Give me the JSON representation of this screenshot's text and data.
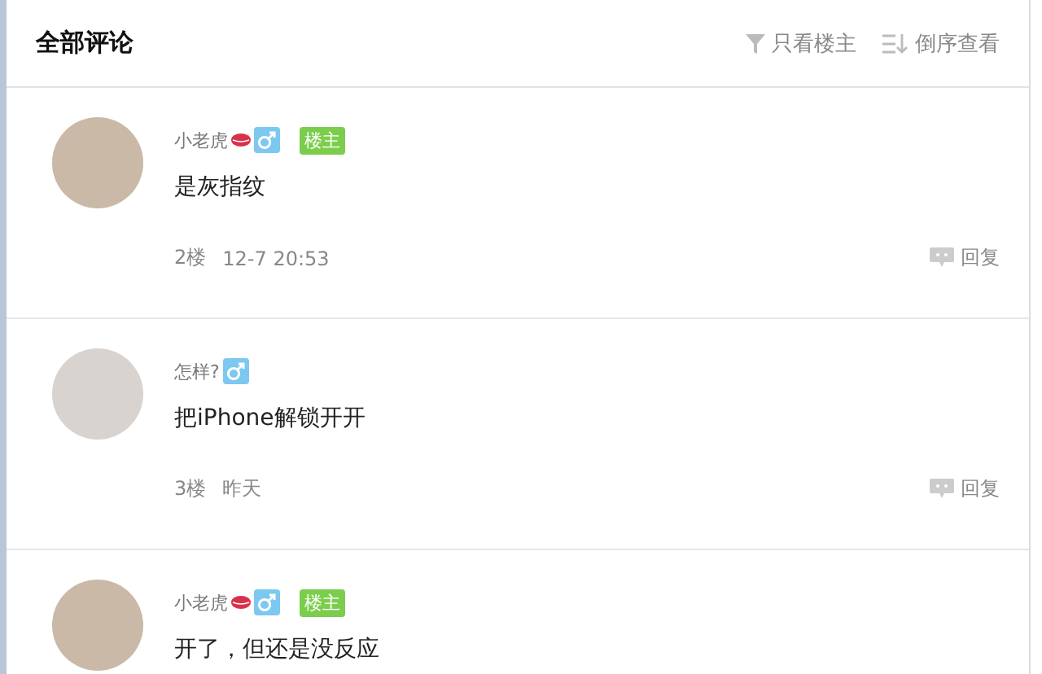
{
  "header": {
    "title": "全部评论",
    "actions": [
      {
        "kind": "filter",
        "label": "只看楼主"
      },
      {
        "kind": "sort",
        "label": "倒序查看"
      }
    ]
  },
  "comments": [
    {
      "user": "小老虎",
      "lips": true,
      "op": true,
      "badge": "楼主",
      "text": "是灰指纹",
      "floor": "2楼",
      "time": "12-7 20:53",
      "reply": "回复"
    },
    {
      "user": "怎样?",
      "lips": false,
      "op": false,
      "text": "把iPhone解锁开开",
      "floor": "3楼",
      "time": "昨天",
      "reply": "回复"
    },
    {
      "user": "小老虎",
      "lips": true,
      "op": true,
      "badge": "楼主",
      "text": "开了，但还是没反应"
    }
  ]
}
